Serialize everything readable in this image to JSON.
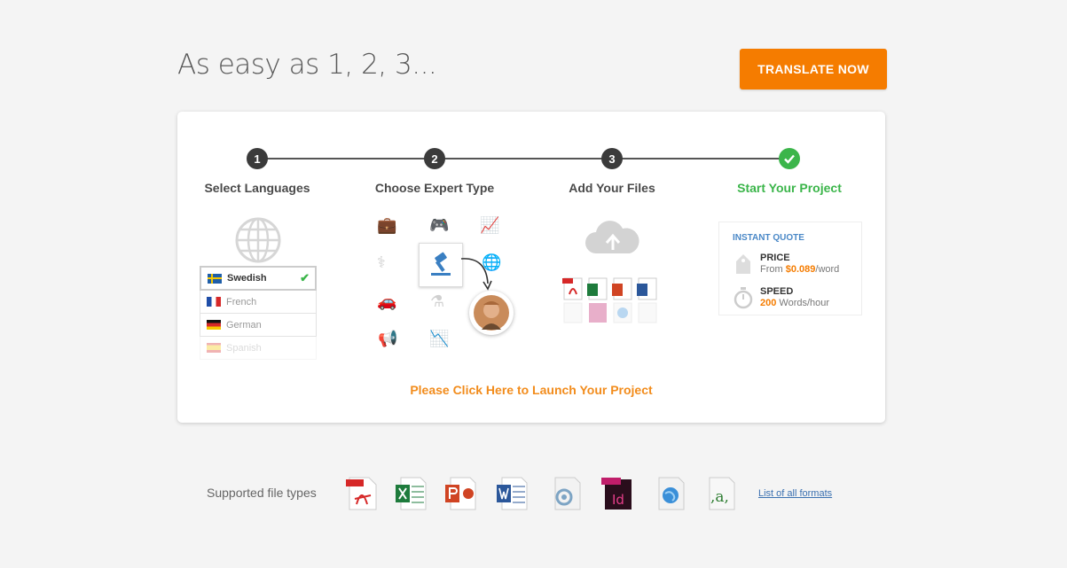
{
  "headline": "As easy as 1, 2, 3...",
  "cta_label": "TRANSLATE NOW",
  "steps": [
    {
      "number": "1",
      "label": "Select Languages"
    },
    {
      "number": "2",
      "label": "Choose Expert Type"
    },
    {
      "number": "3",
      "label": "Add Your Files"
    },
    {
      "number": "",
      "label": "Start Your Project"
    }
  ],
  "languages": [
    {
      "name": "Swedish",
      "selected": true
    },
    {
      "name": "French",
      "selected": false
    },
    {
      "name": "German",
      "selected": false
    },
    {
      "name": "Spanish",
      "selected": false
    }
  ],
  "quote": {
    "title": "INSTANT QUOTE",
    "price_label": "PRICE",
    "price_prefix": "From ",
    "price_value": "$0.089",
    "price_suffix": "/word",
    "speed_label": "SPEED",
    "speed_value": "200",
    "speed_suffix": " Words/hour"
  },
  "launch_text": "Please Click Here to Launch Your Project",
  "supported_label": "Supported file types",
  "formats_link": "List of all formats",
  "colors": {
    "accent": "#f57c00",
    "success": "#3bb54a",
    "link": "#3a70b0"
  }
}
